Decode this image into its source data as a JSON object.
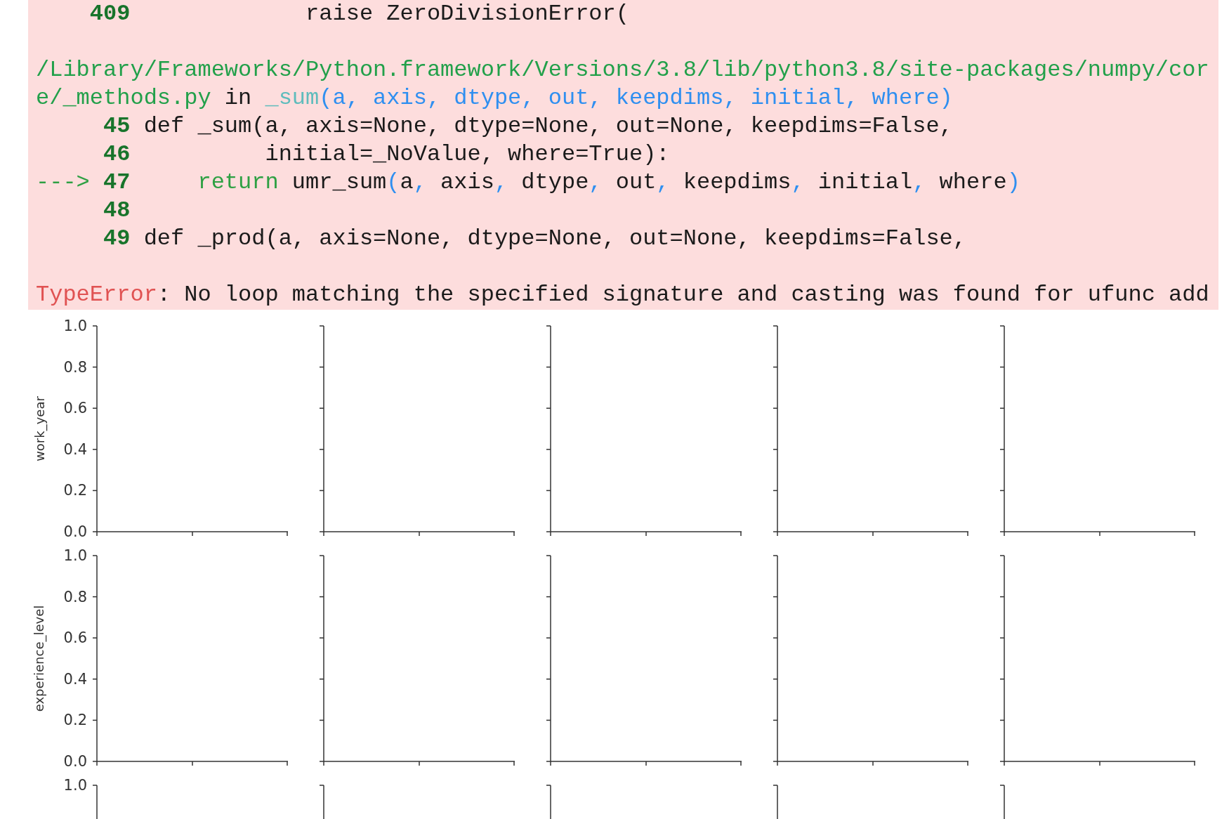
{
  "traceback": {
    "blocks": [
      [
        {
          "lineno": "409",
          "code": [
            {
              "kind": "plain",
              "text": "            raise ZeroDivisionError("
            }
          ]
        }
      ],
      [
        {
          "code": [
            {
              "kind": "path",
              "text": "/Library/Frameworks/Python.framework/Versions/3.8/lib/python3.8/site-packages/numpy/cor"
            }
          ]
        },
        {
          "code": [
            {
              "kind": "path",
              "text": "e/_methods.py"
            },
            {
              "kind": "plain",
              "text": " in "
            },
            {
              "kind": "func",
              "text": "_sum"
            },
            {
              "kind": "args",
              "text": "(a, axis, dtype, out, keepdims, initial, where)"
            }
          ]
        },
        {
          "lineno": "45",
          "code": [
            {
              "kind": "plain",
              "text": "def _sum(a, axis=None, dtype=None, out=None, keepdims=False,"
            }
          ]
        },
        {
          "lineno": "46",
          "code": [
            {
              "kind": "plain",
              "text": "         initial=_NoValue, where=True):"
            }
          ]
        },
        {
          "arrow": "--->",
          "lineno": "47",
          "code": [
            {
              "kind": "keyword",
              "text": "    return"
            },
            {
              "kind": "plain",
              "text": " umr_sum"
            },
            {
              "kind": "args",
              "text": "("
            },
            {
              "kind": "plain",
              "text": "a"
            },
            {
              "kind": "args",
              "text": ", "
            },
            {
              "kind": "plain",
              "text": "axis"
            },
            {
              "kind": "args",
              "text": ", "
            },
            {
              "kind": "plain",
              "text": "dtype"
            },
            {
              "kind": "args",
              "text": ", "
            },
            {
              "kind": "plain",
              "text": "out"
            },
            {
              "kind": "args",
              "text": ", "
            },
            {
              "kind": "plain",
              "text": "keepdims"
            },
            {
              "kind": "args",
              "text": ", "
            },
            {
              "kind": "plain",
              "text": "initial"
            },
            {
              "kind": "args",
              "text": ", "
            },
            {
              "kind": "plain",
              "text": "where"
            },
            {
              "kind": "args",
              "text": ")"
            }
          ]
        },
        {
          "lineno": "48"
        },
        {
          "lineno": "49",
          "code": [
            {
              "kind": "plain",
              "text": "def _prod(a, axis=None, dtype=None, out=None, keepdims=False,"
            }
          ]
        }
      ]
    ],
    "error": {
      "name": "TypeError",
      "message": ": No loop matching the specified signature and casting was found for ufunc add"
    }
  },
  "figure": {
    "rows": [
      {
        "kind": "full",
        "ylabel": "work_year",
        "ytick_labels": [
          "1.0",
          "0.8",
          "0.6",
          "0.4",
          "0.2",
          "0.0"
        ]
      },
      {
        "kind": "full",
        "ylabel": "experience_level",
        "ytick_labels": [
          "1.0",
          "0.8",
          "0.6",
          "0.4",
          "0.2",
          "0.0"
        ]
      },
      {
        "kind": "partial",
        "ytick_labels": [
          "1.0"
        ]
      }
    ]
  }
}
